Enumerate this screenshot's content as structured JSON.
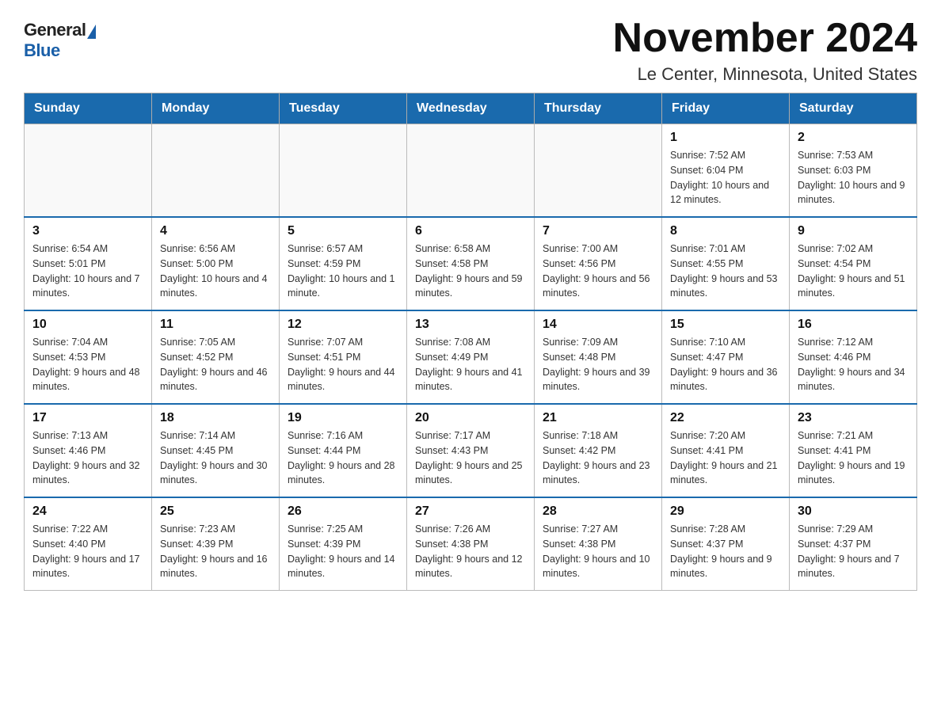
{
  "header": {
    "logo_general": "General",
    "logo_blue": "Blue",
    "title": "November 2024",
    "subtitle": "Le Center, Minnesota, United States"
  },
  "days_of_week": [
    "Sunday",
    "Monday",
    "Tuesday",
    "Wednesday",
    "Thursday",
    "Friday",
    "Saturday"
  ],
  "weeks": [
    [
      {
        "day": "",
        "sunrise": "",
        "sunset": "",
        "daylight": ""
      },
      {
        "day": "",
        "sunrise": "",
        "sunset": "",
        "daylight": ""
      },
      {
        "day": "",
        "sunrise": "",
        "sunset": "",
        "daylight": ""
      },
      {
        "day": "",
        "sunrise": "",
        "sunset": "",
        "daylight": ""
      },
      {
        "day": "",
        "sunrise": "",
        "sunset": "",
        "daylight": ""
      },
      {
        "day": "1",
        "sunrise": "Sunrise: 7:52 AM",
        "sunset": "Sunset: 6:04 PM",
        "daylight": "Daylight: 10 hours and 12 minutes."
      },
      {
        "day": "2",
        "sunrise": "Sunrise: 7:53 AM",
        "sunset": "Sunset: 6:03 PM",
        "daylight": "Daylight: 10 hours and 9 minutes."
      }
    ],
    [
      {
        "day": "3",
        "sunrise": "Sunrise: 6:54 AM",
        "sunset": "Sunset: 5:01 PM",
        "daylight": "Daylight: 10 hours and 7 minutes."
      },
      {
        "day": "4",
        "sunrise": "Sunrise: 6:56 AM",
        "sunset": "Sunset: 5:00 PM",
        "daylight": "Daylight: 10 hours and 4 minutes."
      },
      {
        "day": "5",
        "sunrise": "Sunrise: 6:57 AM",
        "sunset": "Sunset: 4:59 PM",
        "daylight": "Daylight: 10 hours and 1 minute."
      },
      {
        "day": "6",
        "sunrise": "Sunrise: 6:58 AM",
        "sunset": "Sunset: 4:58 PM",
        "daylight": "Daylight: 9 hours and 59 minutes."
      },
      {
        "day": "7",
        "sunrise": "Sunrise: 7:00 AM",
        "sunset": "Sunset: 4:56 PM",
        "daylight": "Daylight: 9 hours and 56 minutes."
      },
      {
        "day": "8",
        "sunrise": "Sunrise: 7:01 AM",
        "sunset": "Sunset: 4:55 PM",
        "daylight": "Daylight: 9 hours and 53 minutes."
      },
      {
        "day": "9",
        "sunrise": "Sunrise: 7:02 AM",
        "sunset": "Sunset: 4:54 PM",
        "daylight": "Daylight: 9 hours and 51 minutes."
      }
    ],
    [
      {
        "day": "10",
        "sunrise": "Sunrise: 7:04 AM",
        "sunset": "Sunset: 4:53 PM",
        "daylight": "Daylight: 9 hours and 48 minutes."
      },
      {
        "day": "11",
        "sunrise": "Sunrise: 7:05 AM",
        "sunset": "Sunset: 4:52 PM",
        "daylight": "Daylight: 9 hours and 46 minutes."
      },
      {
        "day": "12",
        "sunrise": "Sunrise: 7:07 AM",
        "sunset": "Sunset: 4:51 PM",
        "daylight": "Daylight: 9 hours and 44 minutes."
      },
      {
        "day": "13",
        "sunrise": "Sunrise: 7:08 AM",
        "sunset": "Sunset: 4:49 PM",
        "daylight": "Daylight: 9 hours and 41 minutes."
      },
      {
        "day": "14",
        "sunrise": "Sunrise: 7:09 AM",
        "sunset": "Sunset: 4:48 PM",
        "daylight": "Daylight: 9 hours and 39 minutes."
      },
      {
        "day": "15",
        "sunrise": "Sunrise: 7:10 AM",
        "sunset": "Sunset: 4:47 PM",
        "daylight": "Daylight: 9 hours and 36 minutes."
      },
      {
        "day": "16",
        "sunrise": "Sunrise: 7:12 AM",
        "sunset": "Sunset: 4:46 PM",
        "daylight": "Daylight: 9 hours and 34 minutes."
      }
    ],
    [
      {
        "day": "17",
        "sunrise": "Sunrise: 7:13 AM",
        "sunset": "Sunset: 4:46 PM",
        "daylight": "Daylight: 9 hours and 32 minutes."
      },
      {
        "day": "18",
        "sunrise": "Sunrise: 7:14 AM",
        "sunset": "Sunset: 4:45 PM",
        "daylight": "Daylight: 9 hours and 30 minutes."
      },
      {
        "day": "19",
        "sunrise": "Sunrise: 7:16 AM",
        "sunset": "Sunset: 4:44 PM",
        "daylight": "Daylight: 9 hours and 28 minutes."
      },
      {
        "day": "20",
        "sunrise": "Sunrise: 7:17 AM",
        "sunset": "Sunset: 4:43 PM",
        "daylight": "Daylight: 9 hours and 25 minutes."
      },
      {
        "day": "21",
        "sunrise": "Sunrise: 7:18 AM",
        "sunset": "Sunset: 4:42 PM",
        "daylight": "Daylight: 9 hours and 23 minutes."
      },
      {
        "day": "22",
        "sunrise": "Sunrise: 7:20 AM",
        "sunset": "Sunset: 4:41 PM",
        "daylight": "Daylight: 9 hours and 21 minutes."
      },
      {
        "day": "23",
        "sunrise": "Sunrise: 7:21 AM",
        "sunset": "Sunset: 4:41 PM",
        "daylight": "Daylight: 9 hours and 19 minutes."
      }
    ],
    [
      {
        "day": "24",
        "sunrise": "Sunrise: 7:22 AM",
        "sunset": "Sunset: 4:40 PM",
        "daylight": "Daylight: 9 hours and 17 minutes."
      },
      {
        "day": "25",
        "sunrise": "Sunrise: 7:23 AM",
        "sunset": "Sunset: 4:39 PM",
        "daylight": "Daylight: 9 hours and 16 minutes."
      },
      {
        "day": "26",
        "sunrise": "Sunrise: 7:25 AM",
        "sunset": "Sunset: 4:39 PM",
        "daylight": "Daylight: 9 hours and 14 minutes."
      },
      {
        "day": "27",
        "sunrise": "Sunrise: 7:26 AM",
        "sunset": "Sunset: 4:38 PM",
        "daylight": "Daylight: 9 hours and 12 minutes."
      },
      {
        "day": "28",
        "sunrise": "Sunrise: 7:27 AM",
        "sunset": "Sunset: 4:38 PM",
        "daylight": "Daylight: 9 hours and 10 minutes."
      },
      {
        "day": "29",
        "sunrise": "Sunrise: 7:28 AM",
        "sunset": "Sunset: 4:37 PM",
        "daylight": "Daylight: 9 hours and 9 minutes."
      },
      {
        "day": "30",
        "sunrise": "Sunrise: 7:29 AM",
        "sunset": "Sunset: 4:37 PM",
        "daylight": "Daylight: 9 hours and 7 minutes."
      }
    ]
  ]
}
